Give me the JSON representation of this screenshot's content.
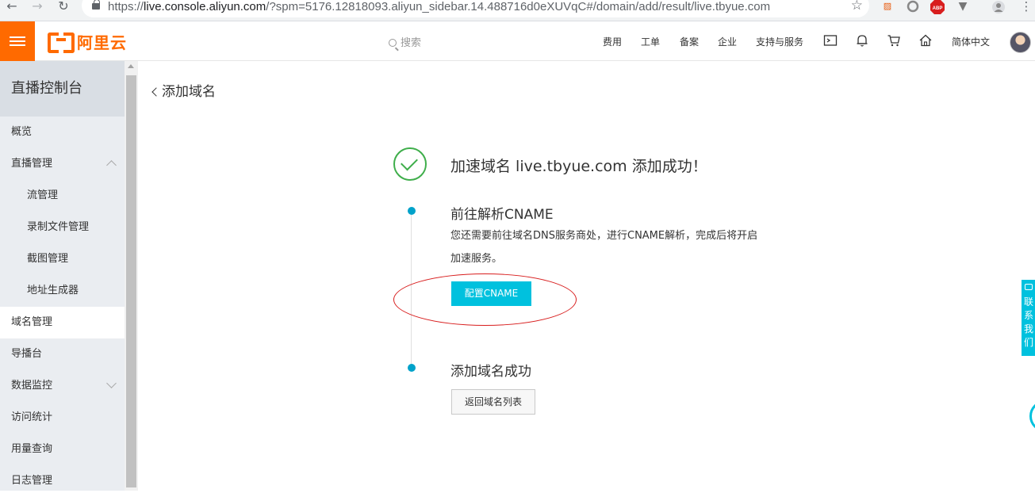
{
  "browser": {
    "url_prefix": "https://",
    "url_host": "live.console.aliyun.com",
    "url_rest": "/?spm=5176.12818093.aliyun_sidebar.14.488716d0eXUVqC#/domain/add/result/live.tbyue.com",
    "extensions": [
      "translate-icon",
      "circle-icon",
      "abp-icon",
      "vivaldi-icon",
      "profile-icon",
      "menu-icon"
    ],
    "abp_label": "ABP"
  },
  "topbar": {
    "logo_text": "阿里云",
    "search_placeholder": "搜索",
    "links": [
      "费用",
      "工单",
      "备案",
      "企业",
      "支持与服务"
    ],
    "language": "简体中文"
  },
  "sidebar": {
    "title": "直播控制台",
    "items": [
      {
        "label": "概览",
        "level": 1
      },
      {
        "label": "直播管理",
        "level": 1,
        "chevron": "up"
      },
      {
        "label": "流管理",
        "level": 2
      },
      {
        "label": "录制文件管理",
        "level": 2
      },
      {
        "label": "截图管理",
        "level": 2
      },
      {
        "label": "地址生成器",
        "level": 2
      },
      {
        "label": "域名管理",
        "level": 1,
        "active": true
      },
      {
        "label": "导播台",
        "level": 1
      },
      {
        "label": "数据监控",
        "level": 1,
        "chevron": "down"
      },
      {
        "label": "访问统计",
        "level": 1
      },
      {
        "label": "用量查询",
        "level": 1
      },
      {
        "label": "日志管理",
        "level": 1
      }
    ]
  },
  "main": {
    "back_label": "添加域名",
    "headline": "加速域名 live.tbyue.com 添加成功！",
    "step1": {
      "title": "前往解析CNAME",
      "desc_line1": "您还需要前往域名DNS服务商处，进行CNAME解析，完成后将开启",
      "desc_line2": "加速服务。",
      "button": "配置CNAME"
    },
    "step2": {
      "title": "添加域名成功",
      "button": "返回域名列表"
    },
    "status_color": "#3fae4b",
    "accent_color": "#00c1de",
    "brand_color": "#ff6a00",
    "annotation_color": "#d81e1e"
  },
  "float": {
    "contact_label": "联系我们"
  }
}
